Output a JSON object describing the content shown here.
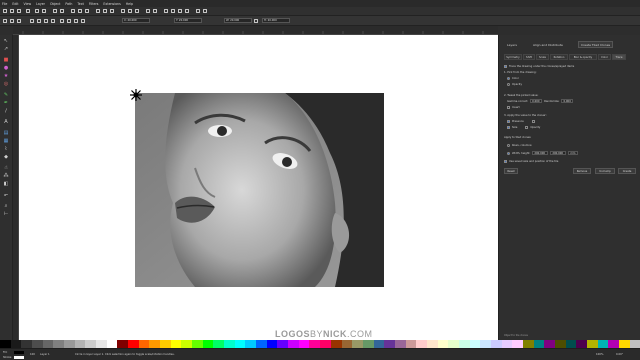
{
  "menubar": {
    "items": [
      "File",
      "Edit",
      "View",
      "Layer",
      "Object",
      "Path",
      "Text",
      "Filters",
      "Extensions",
      "Help"
    ]
  },
  "ctrlbar": {
    "x_value": "X: 20.000",
    "y_value": "Y: 20.000",
    "w_value": "W: 20.000",
    "h_value": "H: 20.000"
  },
  "dock": {
    "tabs": [
      "Layers",
      "Align and Distribute",
      "Create Tiled Clones"
    ],
    "subtabs": [
      "Symmetry",
      "Shift",
      "Scale",
      "Rotation",
      "Blur & opacity",
      "Color",
      "Trace"
    ],
    "rows": [
      "Trace the drawing under the clones/sprayed items",
      "1. Pick from the drawing:",
      "Color",
      "Opacity",
      "2. Tweak the picked value:",
      "Gamma-correct:",
      "Randomize:",
      "Invert",
      "3. Apply the value to the clones':",
      "Presence",
      "Size",
      "Opacity",
      "Apply to tiled clones:",
      "Rows, columns:",
      "Width, height:",
      "Use saved size and position of the tile"
    ],
    "gamma_value": "0.000",
    "randomize_value": "0.000",
    "width_value": "200.000",
    "height_value": "200.000",
    "unit": "mm",
    "buttons": {
      "reset": "Reset",
      "remove": "Remove",
      "unclump": "Unclump",
      "create": "Create"
    },
    "status_hint": "Object to tile clones"
  },
  "watermark": {
    "part1": "LOGOS",
    "part2": "BY",
    "part3": "NICK",
    "part4": ".COM"
  },
  "statusbar": {
    "fill_label": "Fill:",
    "stroke_label": "Stroke:",
    "opacity_value": "100",
    "layer_text": "Layer 1",
    "message": "Circle in layer Layer 1. Click selection again to toggle scale/rotation handles.",
    "zoom_value": "100%",
    "rotate_value": "0.00°"
  },
  "colors": {
    "accent": "#3b6fc6",
    "canvas": "#ffffff",
    "chrome": "#2d2d2d"
  },
  "palette": [
    "#000000",
    "#1a1a1a",
    "#333333",
    "#4d4d4d",
    "#666666",
    "#808080",
    "#999999",
    "#b3b3b3",
    "#cccccc",
    "#e6e6e6",
    "#ffffff",
    "#800000",
    "#ff0000",
    "#ff6600",
    "#ff9900",
    "#ffcc00",
    "#ffff00",
    "#ccff00",
    "#66ff00",
    "#00ff00",
    "#00ff66",
    "#00ffcc",
    "#00ffff",
    "#00ccff",
    "#0066ff",
    "#0000ff",
    "#6600ff",
    "#cc00ff",
    "#ff00ff",
    "#ff0099",
    "#ff0066",
    "#993300",
    "#996633",
    "#999966",
    "#669966",
    "#336699",
    "#663399",
    "#996699",
    "#cc9999",
    "#ffcccc",
    "#ffe6cc",
    "#ffffcc",
    "#e6ffcc",
    "#ccffe6",
    "#ccffff",
    "#cce6ff",
    "#ccccff",
    "#e6ccff",
    "#ffccff",
    "#808000",
    "#008080",
    "#800080",
    "#4d4d00",
    "#004d4d",
    "#4d004d",
    "#b3b300",
    "#00b3b3",
    "#b300b3",
    "#ffd700",
    "#c0c0c0"
  ]
}
